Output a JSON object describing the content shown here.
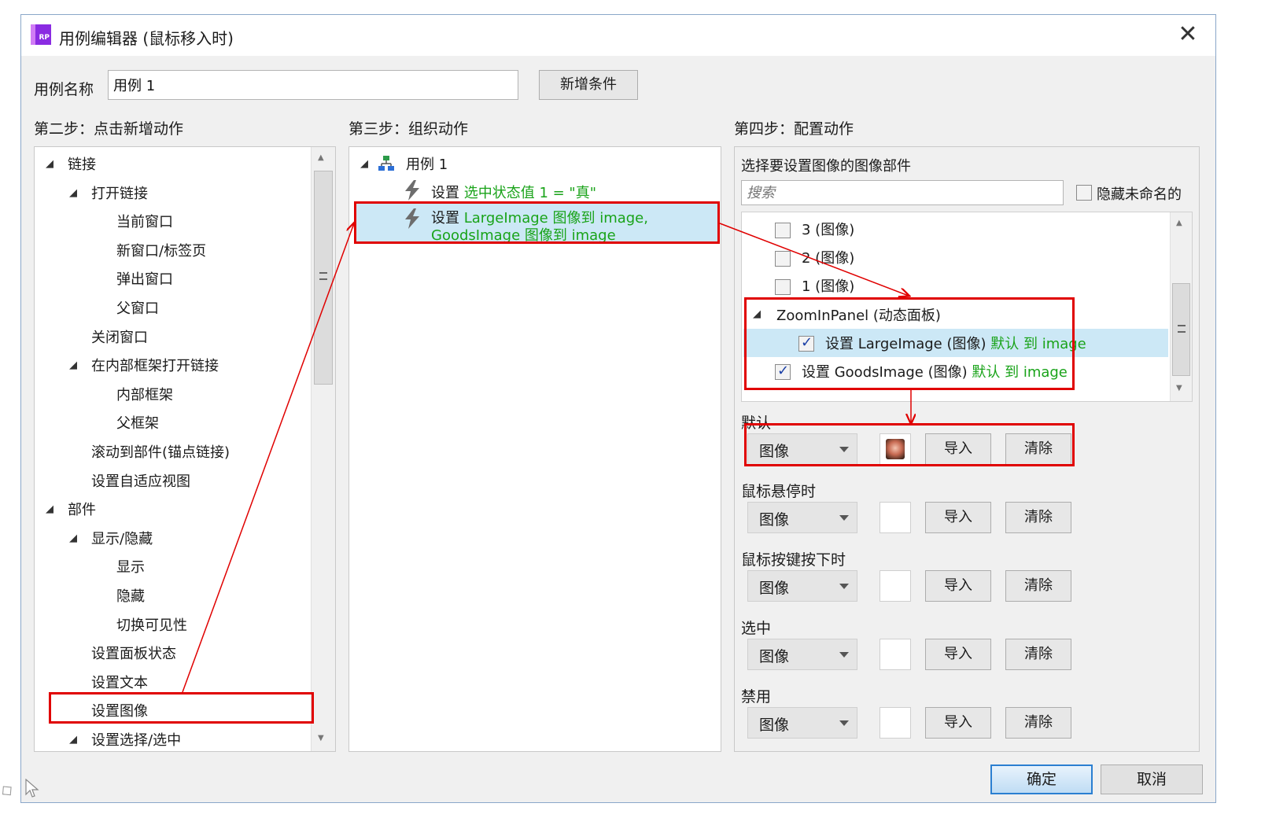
{
  "window": {
    "title": "用例编辑器 (鼠标移入时)",
    "app_icon_text": "RP",
    "close_icon": "close-icon"
  },
  "case_name": {
    "label": "用例名称",
    "value": "用例 1",
    "add_condition_label": "新增条件"
  },
  "step2": {
    "heading": "第二步：点击新增动作",
    "items": [
      {
        "label": "链接",
        "level": 0,
        "expanded": true
      },
      {
        "label": "打开链接",
        "level": 1,
        "expanded": true
      },
      {
        "label": "当前窗口",
        "level": 2
      },
      {
        "label": "新窗口/标签页",
        "level": 2
      },
      {
        "label": "弹出窗口",
        "level": 2
      },
      {
        "label": "父窗口",
        "level": 2
      },
      {
        "label": "关闭窗口",
        "level": 1
      },
      {
        "label": "在内部框架打开链接",
        "level": 1,
        "expanded": true
      },
      {
        "label": "内部框架",
        "level": 2
      },
      {
        "label": "父框架",
        "level": 2
      },
      {
        "label": "滚动到部件(锚点链接)",
        "level": 1
      },
      {
        "label": "设置自适应视图",
        "level": 1
      },
      {
        "label": "部件",
        "level": 0,
        "expanded": true
      },
      {
        "label": "显示/隐藏",
        "level": 1,
        "expanded": true
      },
      {
        "label": "显示",
        "level": 2
      },
      {
        "label": "隐藏",
        "level": 2
      },
      {
        "label": "切换可见性",
        "level": 2
      },
      {
        "label": "设置面板状态",
        "level": 1
      },
      {
        "label": "设置文本",
        "level": 1
      },
      {
        "label": "设置图像",
        "level": 1,
        "highlighted": true
      },
      {
        "label": "设置选择/选中",
        "level": 1,
        "expanded": true
      }
    ]
  },
  "step3": {
    "heading": "第三步：组织动作",
    "case_label": "用例 1",
    "actions": [
      {
        "prefix": "设置",
        "detail": "选中状态值 1 = \"真\""
      },
      {
        "prefix": "设置",
        "detail": "LargeImage 图像到 image,",
        "detail2": "GoodsImage 图像到 image",
        "selected": true
      }
    ]
  },
  "step4": {
    "heading": "第四步：配置动作",
    "subheading": "选择要设置图像的图像部件",
    "search_placeholder": "搜索",
    "hide_unnamed_label": "隐藏未命名的",
    "widgets": [
      {
        "label": "3 (图像)",
        "checked": false
      },
      {
        "label": "2 (图像)",
        "checked": false
      },
      {
        "label": "1 (图像)",
        "checked": false
      }
    ],
    "panel": {
      "label": "ZoomInPanel (动态面板)",
      "children": [
        {
          "prefix": "设置 LargeImage (图像)",
          "detail": "默认 到 image",
          "checked": true,
          "selected": true
        },
        {
          "prefix": "设置 GoodsImage (图像)",
          "detail": "默认 到 image",
          "checked": true
        }
      ]
    },
    "states": [
      {
        "label": "默认",
        "select": "图像",
        "has_image": true,
        "import": "导入",
        "clear": "清除"
      },
      {
        "label": "鼠标悬停时",
        "select": "图像",
        "has_image": false,
        "import": "导入",
        "clear": "清除"
      },
      {
        "label": "鼠标按键按下时",
        "select": "图像",
        "has_image": false,
        "import": "导入",
        "clear": "清除"
      },
      {
        "label": "选中",
        "select": "图像",
        "has_image": false,
        "import": "导入",
        "clear": "清除"
      },
      {
        "label": "禁用",
        "select": "图像",
        "has_image": false,
        "import": "导入",
        "clear": "清除"
      }
    ]
  },
  "footer": {
    "ok_label": "确定",
    "cancel_label": "取消"
  },
  "colors": {
    "accent_green": "#19a319",
    "highlight_red": "#e00000",
    "selection_blue": "#cce8f6",
    "title_icon_purple": "#8a2be2"
  }
}
